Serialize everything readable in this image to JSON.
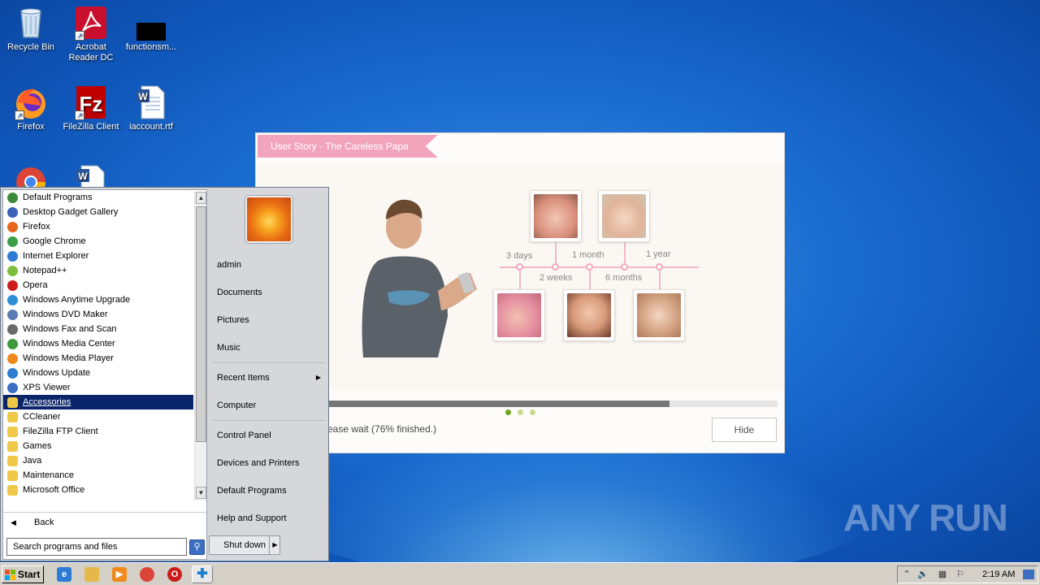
{
  "desktop": {
    "icons": [
      {
        "label": "Recycle Bin"
      },
      {
        "label": "Acrobat Reader DC"
      },
      {
        "label": "functionsm..."
      },
      {
        "label": "Firefox"
      },
      {
        "label": "FileZilla Client"
      },
      {
        "label": "iaccount.rtf"
      },
      {
        "label": ""
      },
      {
        "label": ""
      }
    ],
    "watermark": "ANY RUN"
  },
  "installer": {
    "ribbon_title": "User Story - The Careless Papa",
    "timeline": {
      "top_labels": [
        "3 days",
        "1 month",
        "1 year"
      ],
      "bottom_labels": [
        "2 weeks",
        "6 months"
      ]
    },
    "carousel": {
      "pages": 3,
      "active": 1
    },
    "progress": {
      "percent": 76,
      "status_text": "ease wait (76% finished.)"
    },
    "hide_button": "Hide"
  },
  "start_menu": {
    "programs": [
      {
        "label": "Default Programs",
        "icon": "default-programs-icon",
        "color": "#3a8a3a"
      },
      {
        "label": "Desktop Gadget Gallery",
        "icon": "gadget-icon",
        "color": "#3b62b8"
      },
      {
        "label": "Firefox",
        "icon": "firefox-icon",
        "color": "#e8651c"
      },
      {
        "label": "Google Chrome",
        "icon": "chrome-icon",
        "color": "#3a9e45"
      },
      {
        "label": "Internet Explorer",
        "icon": "ie-icon",
        "color": "#2d7bd4"
      },
      {
        "label": "Notepad++",
        "icon": "notepadpp-icon",
        "color": "#7cbf3a"
      },
      {
        "label": "Opera",
        "icon": "opera-icon",
        "color": "#cc1b1b"
      },
      {
        "label": "Windows Anytime Upgrade",
        "icon": "windows-upgrade-icon",
        "color": "#2f8fd6"
      },
      {
        "label": "Windows DVD Maker",
        "icon": "dvd-maker-icon",
        "color": "#5b7bb5"
      },
      {
        "label": "Windows Fax and Scan",
        "icon": "fax-icon",
        "color": "#6a6a6a"
      },
      {
        "label": "Windows Media Center",
        "icon": "media-center-icon",
        "color": "#3c9a3c"
      },
      {
        "label": "Windows Media Player",
        "icon": "media-player-icon",
        "color": "#f08a1c"
      },
      {
        "label": "Windows Update",
        "icon": "windows-update-icon",
        "color": "#2f7dd0"
      },
      {
        "label": "XPS Viewer",
        "icon": "xps-icon",
        "color": "#3a6fc4"
      },
      {
        "label": "Accessories",
        "icon": "folder-icon",
        "color": "#f0c847",
        "selected": true
      },
      {
        "label": "CCleaner",
        "icon": "folder-icon",
        "color": "#f0c847"
      },
      {
        "label": "FileZilla FTP Client",
        "icon": "folder-icon",
        "color": "#f0c847"
      },
      {
        "label": "Games",
        "icon": "folder-icon",
        "color": "#f0c847"
      },
      {
        "label": "Java",
        "icon": "folder-icon",
        "color": "#f0c847"
      },
      {
        "label": "Maintenance",
        "icon": "folder-icon",
        "color": "#f0c847"
      },
      {
        "label": "Microsoft Office",
        "icon": "folder-icon",
        "color": "#f0c847"
      }
    ],
    "back_label": "Back",
    "search_placeholder": "Search programs and files",
    "right_items": {
      "user": "admin",
      "documents": "Documents",
      "pictures": "Pictures",
      "music": "Music",
      "recent": "Recent Items",
      "computer": "Computer",
      "control_panel": "Control Panel",
      "devices": "Devices and Printers",
      "default_programs": "Default Programs",
      "help": "Help and Support"
    },
    "shutdown_label": "Shut down"
  },
  "taskbar": {
    "start_label": "Start",
    "clock": "2:19 AM"
  }
}
